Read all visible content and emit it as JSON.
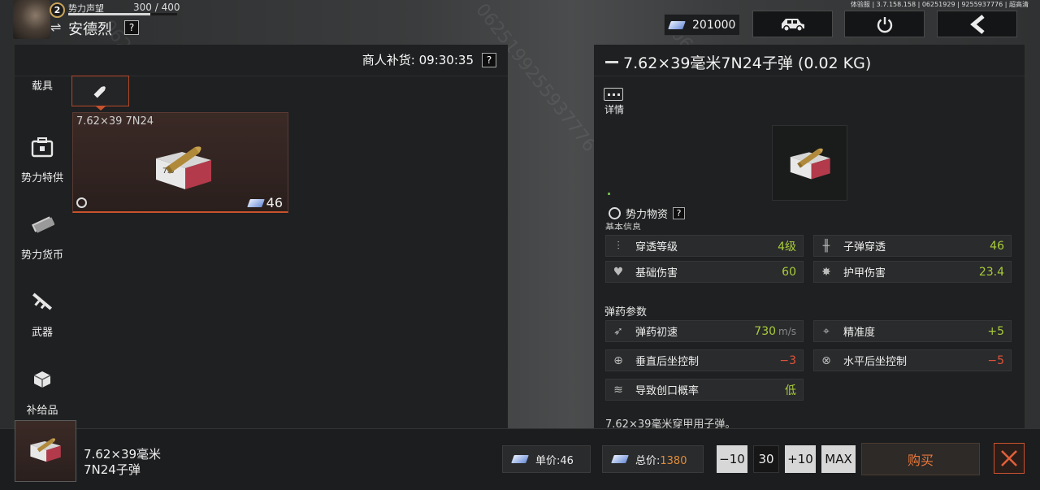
{
  "player": {
    "level": "2",
    "reputation_label": "势力声望",
    "reputation_value": "300 / 400",
    "reputation_progress": 0.75,
    "name": "安德烈",
    "help": "?"
  },
  "server_info": "体验服 | 3.7.158.158 | 06251929 | 9255937776 | 超高清",
  "currency": {
    "amount": "201000",
    "icon": "ticket-icon"
  },
  "top_buttons": {
    "vehicle_icon": "vehicle-icon",
    "power_icon": "power-icon",
    "back_icon": "back-arrow-icon"
  },
  "merchant": {
    "restock_label": "商人补货: 09:30:35",
    "help": "?"
  },
  "categories": [
    {
      "label": "载具",
      "icon": "vehicle-icon"
    },
    {
      "label": "势力特供",
      "icon": "toolbox-icon"
    },
    {
      "label": "势力货币",
      "icon": "money-icon"
    },
    {
      "label": "武器",
      "icon": "rifle-icon"
    },
    {
      "label": "补给品",
      "icon": "supply-box-icon"
    }
  ],
  "subtab": {
    "icon": "bullet-icon"
  },
  "item_card": {
    "name": "7.62×39 7N24",
    "price": "46",
    "faction_icon": "faction-icon"
  },
  "detail": {
    "title": "7.62×39毫米7N24子弹 (0.02 KG)",
    "detail_label": "详情",
    "faction_label": "势力物资",
    "help": "?",
    "basic_info_label": "基本信息",
    "stats": [
      {
        "label": "穿透等级",
        "value": "4级",
        "color": "green",
        "icon": "penetration-level-icon"
      },
      {
        "label": "子弹穿透",
        "value": "46",
        "color": "green",
        "icon": "bullet-penetration-icon"
      },
      {
        "label": "基础伤害",
        "value": "60",
        "color": "green",
        "icon": "broken-heart-icon"
      },
      {
        "label": "护甲伤害",
        "value": "23.4",
        "color": "green",
        "icon": "armor-damage-icon"
      }
    ],
    "ammo_header": "弹药参数",
    "ammo_stats": [
      {
        "label": "弹药初速",
        "value": "730",
        "unit": "m/s",
        "color": "green",
        "icon": "muzzle-velocity-icon"
      },
      {
        "label": "精准度",
        "value": "+5",
        "color": "green",
        "icon": "crosshair-icon"
      },
      {
        "label": "垂直后坐控制",
        "value": "−3",
        "color": "red",
        "icon": "vertical-recoil-icon"
      },
      {
        "label": "水平后坐控制",
        "value": "−5",
        "color": "red",
        "icon": "horizontal-recoil-icon"
      },
      {
        "label": "导致创口概率",
        "value": "低",
        "color": "green",
        "icon": "wound-icon"
      }
    ],
    "description": "7.62×39毫米穿甲用子弹。"
  },
  "selection": {
    "name_line1": "7.62×39毫米",
    "name_line2": "7N24子弹",
    "unit_price_label": "单价:46",
    "total_label": "总价:",
    "total_value": "1380",
    "minus_label": "−10",
    "quantity": "30",
    "plus_label": "+10",
    "max_label": "MAX",
    "buy_label": "购买"
  },
  "colors": {
    "accent": "#c8522e",
    "positive": "#a9cc3b",
    "negative": "#e0533a",
    "price_total": "#e08c3a"
  }
}
